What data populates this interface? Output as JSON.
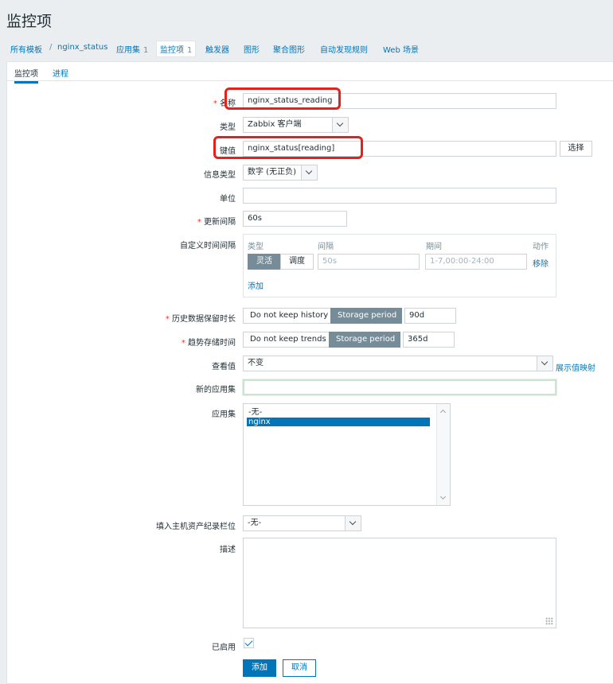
{
  "page": {
    "title": "监控项"
  },
  "breadcrumb": {
    "all_templates": "所有模板",
    "sep": "/",
    "template": "nginx_status",
    "applications": "应用集",
    "applications_count": "1",
    "items": "监控项",
    "items_count": "1",
    "triggers": "触发器",
    "graphs": "图形",
    "screens": "聚合图形",
    "discovery": "自动发现规则",
    "web": "Web 场景"
  },
  "tabs": {
    "item": "监控项",
    "process": "进程"
  },
  "form": {
    "name_label": "名称",
    "name_value": "nginx_status_reading",
    "type_label": "类型",
    "type_value": "Zabbix 客户端",
    "key_label": "键值",
    "key_value": "nginx_status[reading]",
    "select_button": "选择",
    "info_type_label": "信息类型",
    "info_type_value": "数字 (无正负)",
    "units_label": "单位",
    "units_value": "",
    "interval_label": "更新间隔",
    "interval_value": "60s",
    "custom_intervals_label": "自定义时间间隔",
    "custom_intervals": {
      "col_type": "类型",
      "col_interval": "间隔",
      "col_period": "期间",
      "col_action": "动作",
      "flexible": "灵活",
      "scheduling": "调度",
      "interval_placeholder": "50s",
      "period_placeholder": "1-7,00:00-24:00",
      "remove": "移除",
      "add": "添加"
    },
    "history_label": "历史数据保留时长",
    "history_no_keep": "Do not keep history",
    "history_storage": "Storage period",
    "history_value": "90d",
    "trends_label": "趋势存储时间",
    "trends_no_keep": "Do not keep trends",
    "trends_storage": "Storage period",
    "trends_value": "365d",
    "valuemap_label": "查看值",
    "valuemap_value": "不变",
    "valuemap_link": "展示值映射",
    "new_app_label": "新的应用集",
    "new_app_value": "",
    "apps_label": "应用集",
    "apps_options": [
      "-无-",
      "nginx"
    ],
    "inventory_label": "填入主机资产纪录栏位",
    "inventory_value": "-无-",
    "description_label": "描述",
    "enabled_label": "已启用",
    "add_button": "添加",
    "cancel_button": "取消"
  },
  "colors": {
    "accent": "#0275b8",
    "highlight": "#e5211b",
    "required": "#e33734"
  }
}
